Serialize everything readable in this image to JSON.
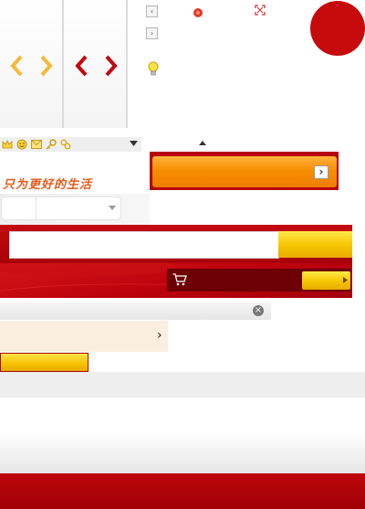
{
  "colors": {
    "brand_red": "#c50a0c",
    "dark_red": "#9b0006",
    "orange": "#f08a00",
    "gold": "#f7c800",
    "cream": "#faeee0"
  },
  "icons": {
    "arrows_light": [
      "chevron-left-icon",
      "chevron-right-icon"
    ],
    "arrows_dark": [
      "chevron-left-icon",
      "chevron-right-icon"
    ],
    "small_buttons": [
      "chevron-left-icon",
      "chevron-right-icon"
    ],
    "toolbar": [
      "crown-icon",
      "smiley-icon",
      "mail-icon",
      "key-icon",
      "link-icon",
      "caret-down-icon"
    ],
    "misc": [
      "gear-badge-icon",
      "expand-icon",
      "lightbulb-icon",
      "caret-up-icon",
      "cart-icon",
      "clear-icon"
    ]
  },
  "slogan": "只为更好的生活",
  "glyphs": {
    "left": "‹",
    "right": "›",
    "chevron": "›",
    "close": "×"
  }
}
